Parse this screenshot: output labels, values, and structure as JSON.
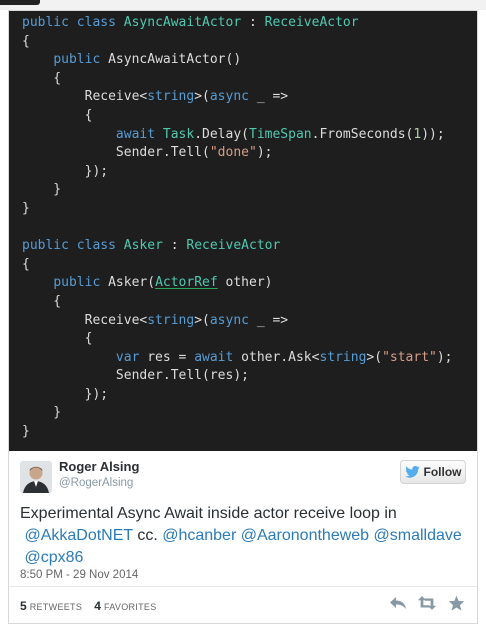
{
  "code": {
    "lines": [
      [
        [
          "kw",
          "public"
        ],
        [
          "t",
          " "
        ],
        [
          "kw",
          "class"
        ],
        [
          "t",
          " "
        ],
        [
          "type",
          "AsyncAwaitActor"
        ],
        [
          "t",
          " : "
        ],
        [
          "type",
          "ReceiveActor"
        ]
      ],
      [
        [
          "t",
          "{"
        ]
      ],
      [
        [
          "t",
          "    "
        ],
        [
          "kw",
          "public"
        ],
        [
          "t",
          " AsyncAwaitActor()"
        ]
      ],
      [
        [
          "t",
          "    {"
        ]
      ],
      [
        [
          "t",
          "        Receive<"
        ],
        [
          "kw",
          "string"
        ],
        [
          "t",
          ">("
        ],
        [
          "kw",
          "async"
        ],
        [
          "t",
          " _ =>"
        ]
      ],
      [
        [
          "t",
          "        {"
        ]
      ],
      [
        [
          "t",
          "            "
        ],
        [
          "kw",
          "await"
        ],
        [
          "t",
          " "
        ],
        [
          "type",
          "Task"
        ],
        [
          "t",
          ".Delay("
        ],
        [
          "type",
          "TimeSpan"
        ],
        [
          "t",
          ".FromSeconds("
        ],
        [
          "num",
          "1"
        ],
        [
          "t",
          "));"
        ]
      ],
      [
        [
          "t",
          "            Sender.Tell("
        ],
        [
          "str",
          "\"done\""
        ],
        [
          "t",
          ");"
        ]
      ],
      [
        [
          "t",
          "        });"
        ]
      ],
      [
        [
          "t",
          "    }"
        ]
      ],
      [
        [
          "t",
          "}"
        ]
      ],
      [
        [
          "t",
          ""
        ]
      ],
      [
        [
          "kw",
          "public"
        ],
        [
          "t",
          " "
        ],
        [
          "kw",
          "class"
        ],
        [
          "t",
          " "
        ],
        [
          "type",
          "Asker"
        ],
        [
          "t",
          " : "
        ],
        [
          "type",
          "ReceiveActor"
        ]
      ],
      [
        [
          "t",
          "{"
        ]
      ],
      [
        [
          "t",
          "    "
        ],
        [
          "kw",
          "public"
        ],
        [
          "t",
          " Asker("
        ],
        [
          "typeul",
          "ActorRef"
        ],
        [
          "t",
          " other)"
        ]
      ],
      [
        [
          "t",
          "    {"
        ]
      ],
      [
        [
          "t",
          "        Receive<"
        ],
        [
          "kw",
          "string"
        ],
        [
          "t",
          ">("
        ],
        [
          "kw",
          "async"
        ],
        [
          "t",
          " _ =>"
        ]
      ],
      [
        [
          "t",
          "        {"
        ]
      ],
      [
        [
          "t",
          "            "
        ],
        [
          "kw",
          "var"
        ],
        [
          "t",
          " res = "
        ],
        [
          "kw",
          "await"
        ],
        [
          "t",
          " other.Ask<"
        ],
        [
          "kw",
          "string"
        ],
        [
          "t",
          ">("
        ],
        [
          "str",
          "\"start\""
        ],
        [
          "t",
          ");"
        ]
      ],
      [
        [
          "t",
          "            Sender.Tell(res);"
        ]
      ],
      [
        [
          "t",
          "        });"
        ]
      ],
      [
        [
          "t",
          "    }"
        ]
      ],
      [
        [
          "t",
          "}"
        ]
      ]
    ]
  },
  "tweet": {
    "author_name": "Roger Alsing",
    "author_handle": "@RogerAlsing",
    "follow_label": "Follow",
    "text_prefix": "Experimental Async Await inside actor receive loop in",
    "mention_1": "@AkkaDotNET",
    "text_mid": " cc. ",
    "mention_2": "@hcanber",
    "mention_3": "@Aaronontheweb",
    "mention_4": "@smalldave",
    "mention_5": "@cpx86",
    "timestamp": "8:50 PM - 29 Nov 2014",
    "retweets_count": "5",
    "retweets_label": "RETWEETS",
    "favorites_count": "4",
    "favorites_label": "FAVORITES",
    "icons": {
      "follow": "twitter-bird-icon",
      "reply": "reply-icon",
      "retweet": "retweet-icon",
      "favorite": "star-icon"
    }
  }
}
